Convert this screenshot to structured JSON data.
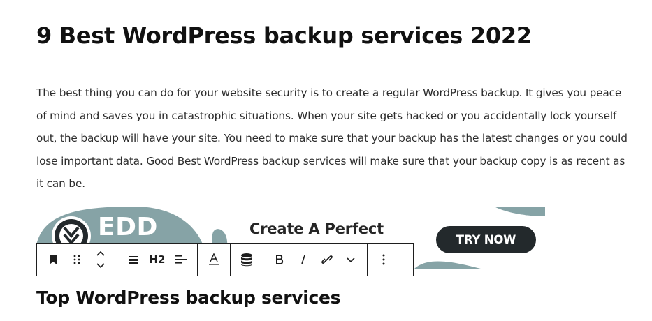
{
  "post": {
    "title": "9 Best WordPress backup services 2022",
    "paragraph": "The best thing you can do for your website security is to create a regular WordPress backup. It gives you peace of mind and saves you in catastrophic situations. When your site gets hacked or you accidentally lock yourself out, the backup will have your site. You need to make sure that your backup has the latest changes or you could lose important data. Good Best WordPress backup services will make sure that your backup copy is as recent as it can be.",
    "subheading": "Top WordPress backup services"
  },
  "banner": {
    "brand": "EDD",
    "headline": "Create A Perfect",
    "cta": "TRY NOW",
    "colors": {
      "accent": "#86a3a6",
      "button": "#23292c"
    }
  },
  "toolbar": {
    "heading_level": "H2",
    "icons": [
      "bookmark-icon",
      "drag-handle-icon",
      "move-up-down-icon",
      "align-icon",
      "heading-level",
      "text-align-icon",
      "text-color-icon",
      "database-icon",
      "bold-icon",
      "italic-icon",
      "link-icon",
      "chevron-down-icon",
      "more-options-icon"
    ]
  }
}
